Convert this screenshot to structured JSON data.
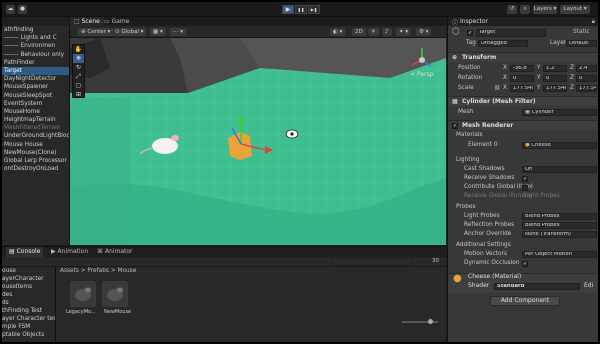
{
  "topbar": {
    "play": "▶",
    "pause": "❚❚",
    "step": "▶❚",
    "layers_label": "Layers",
    "layout_label": "Layout"
  },
  "hierarchy": {
    "items": [
      {
        "label": "athfinding",
        "state": "normal"
      },
      {
        "label": "------- Lights and C",
        "state": "normal"
      },
      {
        "label": "------- Environmen",
        "state": "normal"
      },
      {
        "label": "------- Behaviour only",
        "state": "normal"
      },
      {
        "label": "PathFinder",
        "state": "normal"
      },
      {
        "label": "Target",
        "state": "selected"
      },
      {
        "label": "DayNightDetector",
        "state": "normal"
      },
      {
        "label": "MouseSpawner",
        "state": "normal"
      },
      {
        "label": "MouseSleepSpot",
        "state": "normal"
      },
      {
        "label": "EventSystem",
        "state": "normal"
      },
      {
        "label": "MouseHome",
        "state": "normal"
      },
      {
        "label": "HeightmapTerrain",
        "state": "normal"
      },
      {
        "label": "MeshFilteredTerrain",
        "state": "dim"
      },
      {
        "label": "UnderGroundLightBlocke",
        "state": "normal"
      },
      {
        "label": "Mouse House",
        "state": "normal"
      },
      {
        "label": "NewMouse(Clone)",
        "state": "normal"
      },
      {
        "label": "Global Lerp Processor",
        "state": "normal"
      },
      {
        "label": "ontDestroyOnLoad",
        "state": "normal"
      }
    ]
  },
  "scene": {
    "tabs": [
      "Scene",
      "Game"
    ],
    "pivot": "Center",
    "space": "Global",
    "persp": "< Persp"
  },
  "inspector": {
    "tab": "Inspector",
    "object_name": "Target",
    "static_label": "Static",
    "tag_label": "Tag",
    "tag_value": "Untagged",
    "layer_label": "Layer",
    "layer_value": "Default",
    "transform": {
      "title": "Transform",
      "position_label": "Position",
      "position": {
        "x": "-36.8",
        "y": "1.2",
        "z": "2.4"
      },
      "rotation_label": "Rotation",
      "rotation": {
        "x": "0",
        "y": "0",
        "z": "0"
      },
      "scale_label": "Scale",
      "scale": {
        "x": "177.5403",
        "y": "177.5403",
        "z": "177.5403"
      }
    },
    "mesh_filter": {
      "title": "Cylinder (Mesh Filter)",
      "mesh_label": "Mesh",
      "mesh_value": "Cylinder"
    },
    "mesh_renderer": {
      "title": "Mesh Renderer",
      "materials_label": "Materials",
      "element0_label": "Element 0",
      "element0_value": "Cheese",
      "lighting_label": "Lighting",
      "cast_shadows_label": "Cast Shadows",
      "cast_shadows_value": "On",
      "receive_shadows_label": "Receive Shadows",
      "contribute_gi_label": "Contribute Global Illumi",
      "receive_gi_label": "Receive Global Illumina",
      "receive_gi_value": "Light Probes",
      "probes_label": "Probes",
      "light_probes_label": "Light Probes",
      "light_probes_value": "Blend Probes",
      "reflection_probes_label": "Reflection Probes",
      "reflection_probes_value": "Blend Probes",
      "anchor_override_label": "Anchor Override",
      "anchor_override_value": "None (Transform)",
      "additional_label": "Additional Settings",
      "motion_vectors_label": "Motion Vectors",
      "motion_vectors_value": "Per Object Motion",
      "dynamic_occlusion_label": "Dynamic Occlusion"
    },
    "material": {
      "name": "Cheese (Material)",
      "shader_label": "Shader",
      "shader_value": "Standard",
      "edit_label": "Edi"
    },
    "add_component": "Add Component"
  },
  "bottom": {
    "tabs": [
      "Console",
      "Animation",
      "Animator"
    ],
    "project_items": [
      "ouse",
      "ayerCharacter",
      "ouseItems",
      "des",
      "ds",
      "thFinding Test",
      "ayer Character test",
      "mple FSM",
      "ptable Objects"
    ],
    "breadcrumb": "Assets > Prefabs > Mouse",
    "assets": [
      "LegacyMo...",
      "NewMouse"
    ],
    "count": "30"
  },
  "colors": {
    "selection": "#2c5d87",
    "accent": "#3c5d8a",
    "ground": "#3fbf8f"
  }
}
